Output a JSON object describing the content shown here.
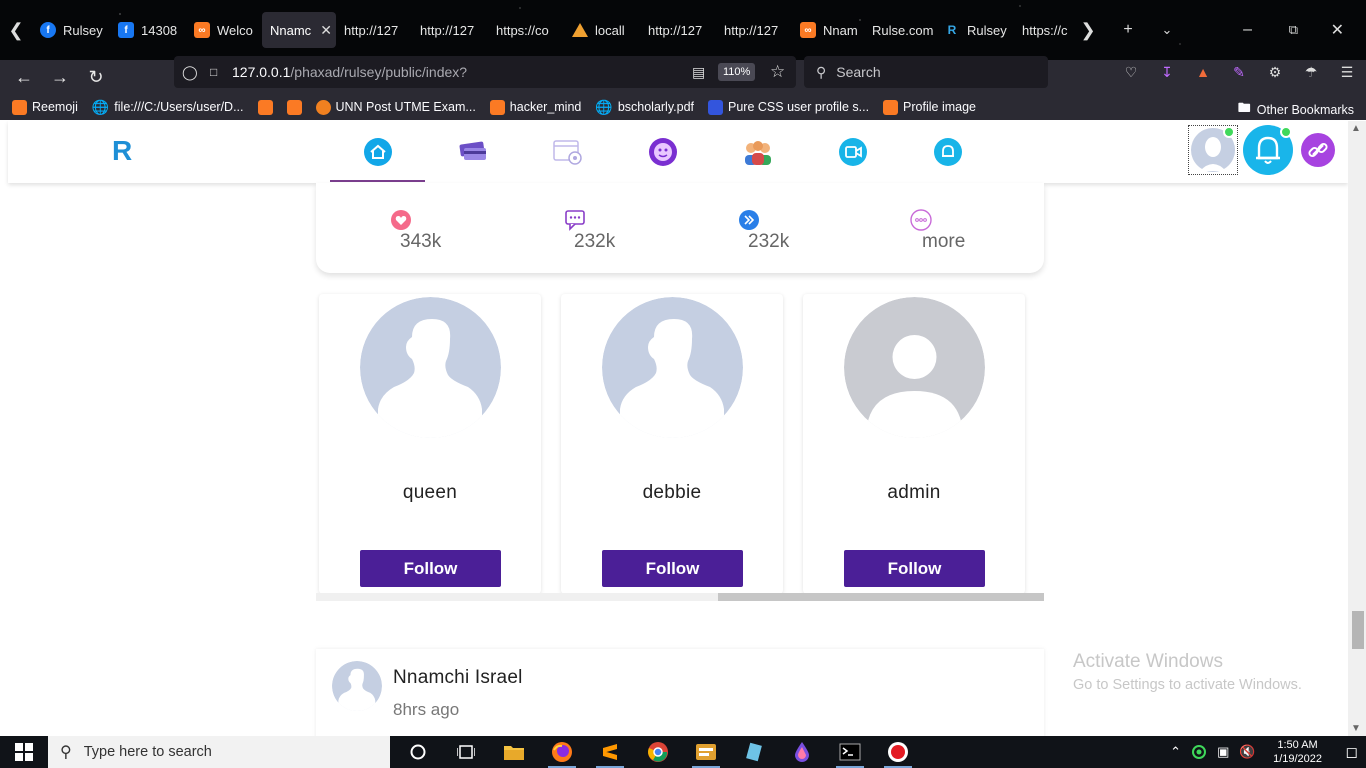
{
  "browser": {
    "tabs": [
      {
        "title": "Rulsey",
        "icon": "facebook-icon",
        "active": false
      },
      {
        "title": "14308",
        "icon": "facebook-square-icon",
        "active": false
      },
      {
        "title": "Welco",
        "icon": "xampp-icon",
        "active": false
      },
      {
        "title": "Nnamc",
        "icon": "",
        "active": true
      },
      {
        "title": "http://127",
        "icon": "",
        "active": false
      },
      {
        "title": "http://127",
        "icon": "",
        "active": false
      },
      {
        "title": "https://co",
        "icon": "",
        "active": false
      },
      {
        "title": "locall",
        "icon": "vlc-icon",
        "active": false
      },
      {
        "title": "http://127",
        "icon": "",
        "active": false
      },
      {
        "title": "http://127",
        "icon": "",
        "active": false
      },
      {
        "title": "Nnam",
        "icon": "xampp-icon",
        "active": false
      },
      {
        "title": "Rulse.com",
        "icon": "",
        "active": false
      },
      {
        "title": "Rulsey",
        "icon": "rulsey-icon",
        "active": false
      },
      {
        "title": "https://c",
        "icon": "",
        "active": false
      }
    ],
    "url_host": "127.0.0.1",
    "url_path": "/phaxad/rulsey/public/index?",
    "zoom": "110%",
    "search_placeholder": "Search",
    "bookmarks": [
      {
        "label": "Reemoji",
        "icon": "xampp-icon"
      },
      {
        "label": "file:///C:/Users/user/D...",
        "icon": "globe-icon"
      },
      {
        "label": "",
        "icon": "xampp-icon"
      },
      {
        "label": "",
        "icon": "xampp-icon"
      },
      {
        "label": "UNN Post UTME Exam...",
        "icon": "unn-icon"
      },
      {
        "label": "hacker_mind",
        "icon": "xampp-icon"
      },
      {
        "label": "bscholarly.pdf",
        "icon": "globe-icon"
      },
      {
        "label": "Pure CSS user profile s...",
        "icon": "codepen-icon"
      },
      {
        "label": "Profile image",
        "icon": "xampp-icon"
      }
    ],
    "other_bookmarks": "Other Bookmarks"
  },
  "app": {
    "logo": "R",
    "nav": [
      {
        "name": "home",
        "active": true
      },
      {
        "name": "payments",
        "active": false
      },
      {
        "name": "browse",
        "active": false
      },
      {
        "name": "emoji",
        "active": false
      },
      {
        "name": "people",
        "active": false
      },
      {
        "name": "video",
        "active": false
      },
      {
        "name": "notifications",
        "active": false
      }
    ]
  },
  "stats": [
    {
      "icon": "heart-icon",
      "value": "343k"
    },
    {
      "icon": "comment-icon",
      "value": "232k"
    },
    {
      "icon": "share-icon",
      "value": "232k"
    },
    {
      "icon": "more-icon",
      "value": "more"
    }
  ],
  "suggestions": [
    {
      "name": "queen",
      "follow_label": "Follow",
      "avatar": "silhouette"
    },
    {
      "name": "debbie",
      "follow_label": "Follow",
      "avatar": "silhouette"
    },
    {
      "name": "admin",
      "follow_label": "Follow",
      "avatar": "default-grey"
    }
  ],
  "post": {
    "author": "Nnamchi Israel",
    "time": "8hrs ago"
  },
  "watermark": {
    "line1": "Activate Windows",
    "line2": "Go to Settings to activate Windows."
  },
  "taskbar": {
    "search_placeholder": "Type here to search",
    "time": "1:50 AM",
    "date": "1/19/2022"
  }
}
